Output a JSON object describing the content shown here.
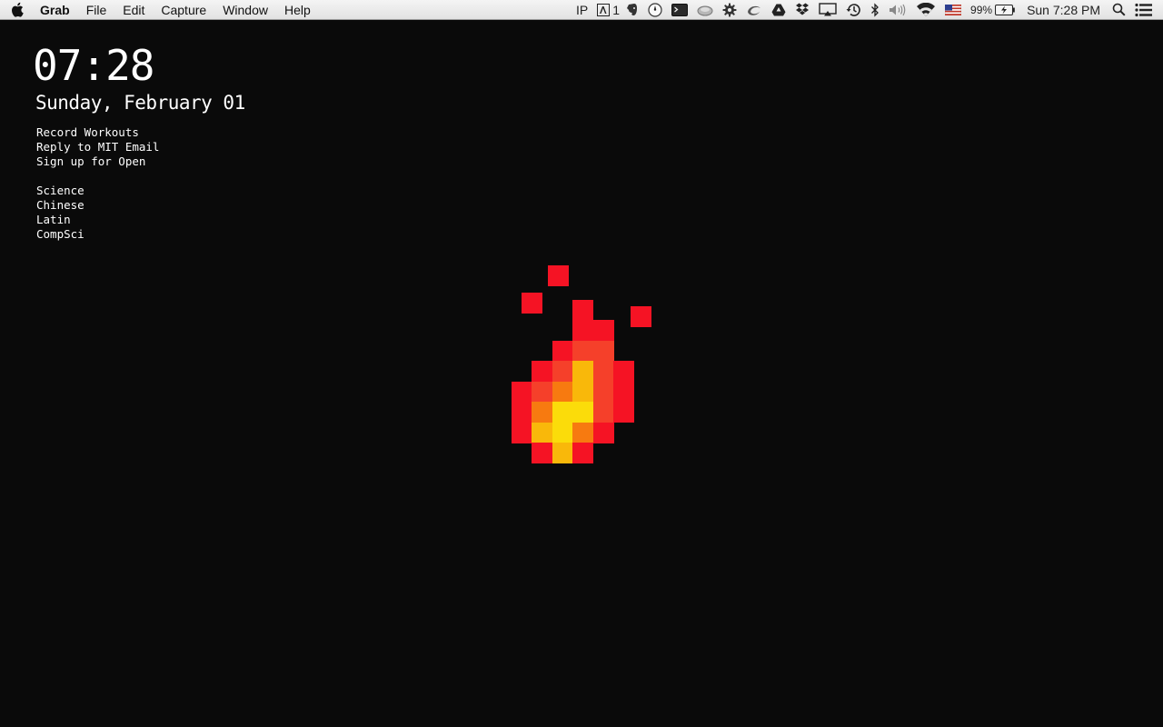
{
  "menubar": {
    "app_name": "Grab",
    "menus": [
      "File",
      "Edit",
      "Capture",
      "Window",
      "Help"
    ],
    "status": {
      "ip_label": "IP",
      "adobe_count": "1",
      "battery_percent": "99%",
      "clock": "Sun 7:28 PM"
    },
    "icons": [
      "apple-icon",
      "adobe-icon",
      "evernote-icon",
      "compass-icon",
      "terminal-icon",
      "cloud-icon",
      "gear-icon",
      "swirl-icon",
      "google-drive-icon",
      "dropbox-icon",
      "airplay-icon",
      "time-machine-icon",
      "bluetooth-icon",
      "volume-icon",
      "wifi-icon",
      "us-flag-icon",
      "battery-icon",
      "spotlight-icon",
      "notification-center-icon"
    ]
  },
  "desktop": {
    "time": "07:28",
    "date": "Sunday, February 01",
    "todos": [
      "Record Workouts",
      "Reply to MIT Email",
      "Sign up for Open"
    ],
    "subjects": [
      "Science",
      "Chinese",
      "Latin",
      "CompSci"
    ]
  },
  "colors": {
    "background": "#0a0a0a",
    "fire_red": "#f51324",
    "fire_orange_red": "#f5402a",
    "fire_orange": "#f77a10",
    "fire_amber": "#f9b80a",
    "fire_yellow": "#fbdc0a"
  }
}
